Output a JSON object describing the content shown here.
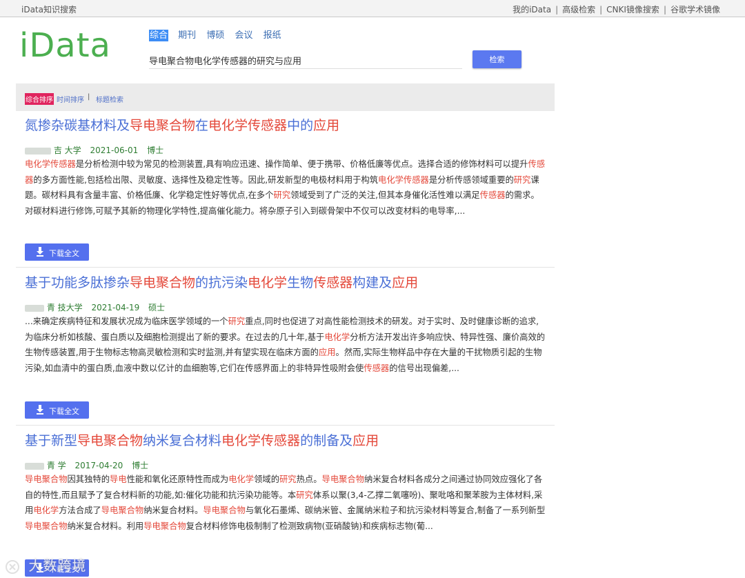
{
  "topbar": {
    "site_name": "iData知识搜索",
    "links": [
      "我的iData",
      "高级检索",
      "CNKI镜像搜索",
      "谷歌学术镜像"
    ]
  },
  "logo": "iData",
  "search": {
    "tabs": [
      "综合",
      "期刊",
      "博硕",
      "会议",
      "报纸"
    ],
    "active_tab": "综合",
    "query": "导电聚合物电化学传感器的研究与应用",
    "button_label": "检索"
  },
  "sort": {
    "active": "综合排序",
    "time": "时间排序",
    "divider": "|",
    "title": "标题检索"
  },
  "results": [
    {
      "title": "氮掺杂碳基材料及导电聚合物在电化学传感器中的应用",
      "school_partial": "吉 大学",
      "date": "2021-06-01",
      "degree": "博士",
      "abstract": "电化学传感器是分析检测中较为常见的检测装置,具有响应迅速、操作简单、便于携带、价格低廉等优点。选择合适的修饰材料可以提升传感器的多方面性能,包括检出限、灵敏度、选择性及稳定性等。因此,研发新型的电极材料用于构筑电化学传感器是分析传感领域重要的研究课题。碳材料具有含量丰富、价格低廉、化学稳定性好等优点,在多个研究领域受到了广泛的关注,但其本身催化活性难以满足传感器的需求。对碳材料进行修饰,可赋予其新的物理化学特性,提高催化能力。将杂原子引入到碳骨架中不仅可以改变材料的电导率,...",
      "download_label": "下载全文"
    },
    {
      "title": "基于功能多肽掺杂导电聚合物的抗污染电化学生物传感器构建及应用",
      "school_partial": "青 技大学",
      "date": "2021-04-19",
      "degree": "硕士",
      "abstract": "...来确定疾病特征和发展状况成为临床医学领域的一个研究重点,同时也促进了对高性能检测技术的研发。对于实时、及时健康诊断的追求,为临床分析如核酸、蛋白质以及细胞检测提出了新的要求。在过去的几十年,基于电化学分析方法开发出许多响应快、特异性强、廉价高效的生物传感装置,用于生物标志物高灵敏检测和实时监测,并有望实现在临床方面的应用。然而,实际生物样品中存在大量的干扰物质引起的生物污染,如血清中的蛋白质,血液中数以亿计的血细胞等,它们在传感界面上的非特异性吸附会使传感器的信号出现偏差,...",
      "download_label": "下载全文"
    },
    {
      "title": "基于新型导电聚合物纳米复合材料电化学传感器的制备及应用",
      "school_partial": "青 学",
      "date": "2017-04-20",
      "degree": "博士",
      "abstract": "导电聚合物因其独特的导电性能和氧化还原特性而成为电化学领域的研究热点。导电聚合物纳米复合材料各成分之间通过协同效应强化了各自的特性,而且赋予了复合材料新的功能,如:催化功能和抗污染功能等。本研究体系以聚(3,4-乙撑二氧噻吩)、聚吡咯和聚苯胺为主体材料,采用电化学方法合成了导电聚合物纳米复合材料。导电聚合物与氧化石墨烯、碳纳米管、金属纳米粒子和抗污染材料等复合,制备了一系列新型导电聚合物纳米复合材料。利用导电聚合物复合材料修饰电极制制了检测致病物(亚硝酸钠)和疾病标志物(葡...",
      "download_label": "下载全文"
    }
  ],
  "highlight_terms": [
    "导电聚合物",
    "电化学传感器",
    "电化学",
    "传感器",
    "研究",
    "应用",
    "导电"
  ],
  "watermark": "大数跨境",
  "colors": {
    "logo": "#4caf50",
    "link": "#4a6fd6",
    "highlight": "#e4483a",
    "meta": "#2e7d32",
    "button": "#5470ee",
    "sort_active": "#e0245e"
  }
}
